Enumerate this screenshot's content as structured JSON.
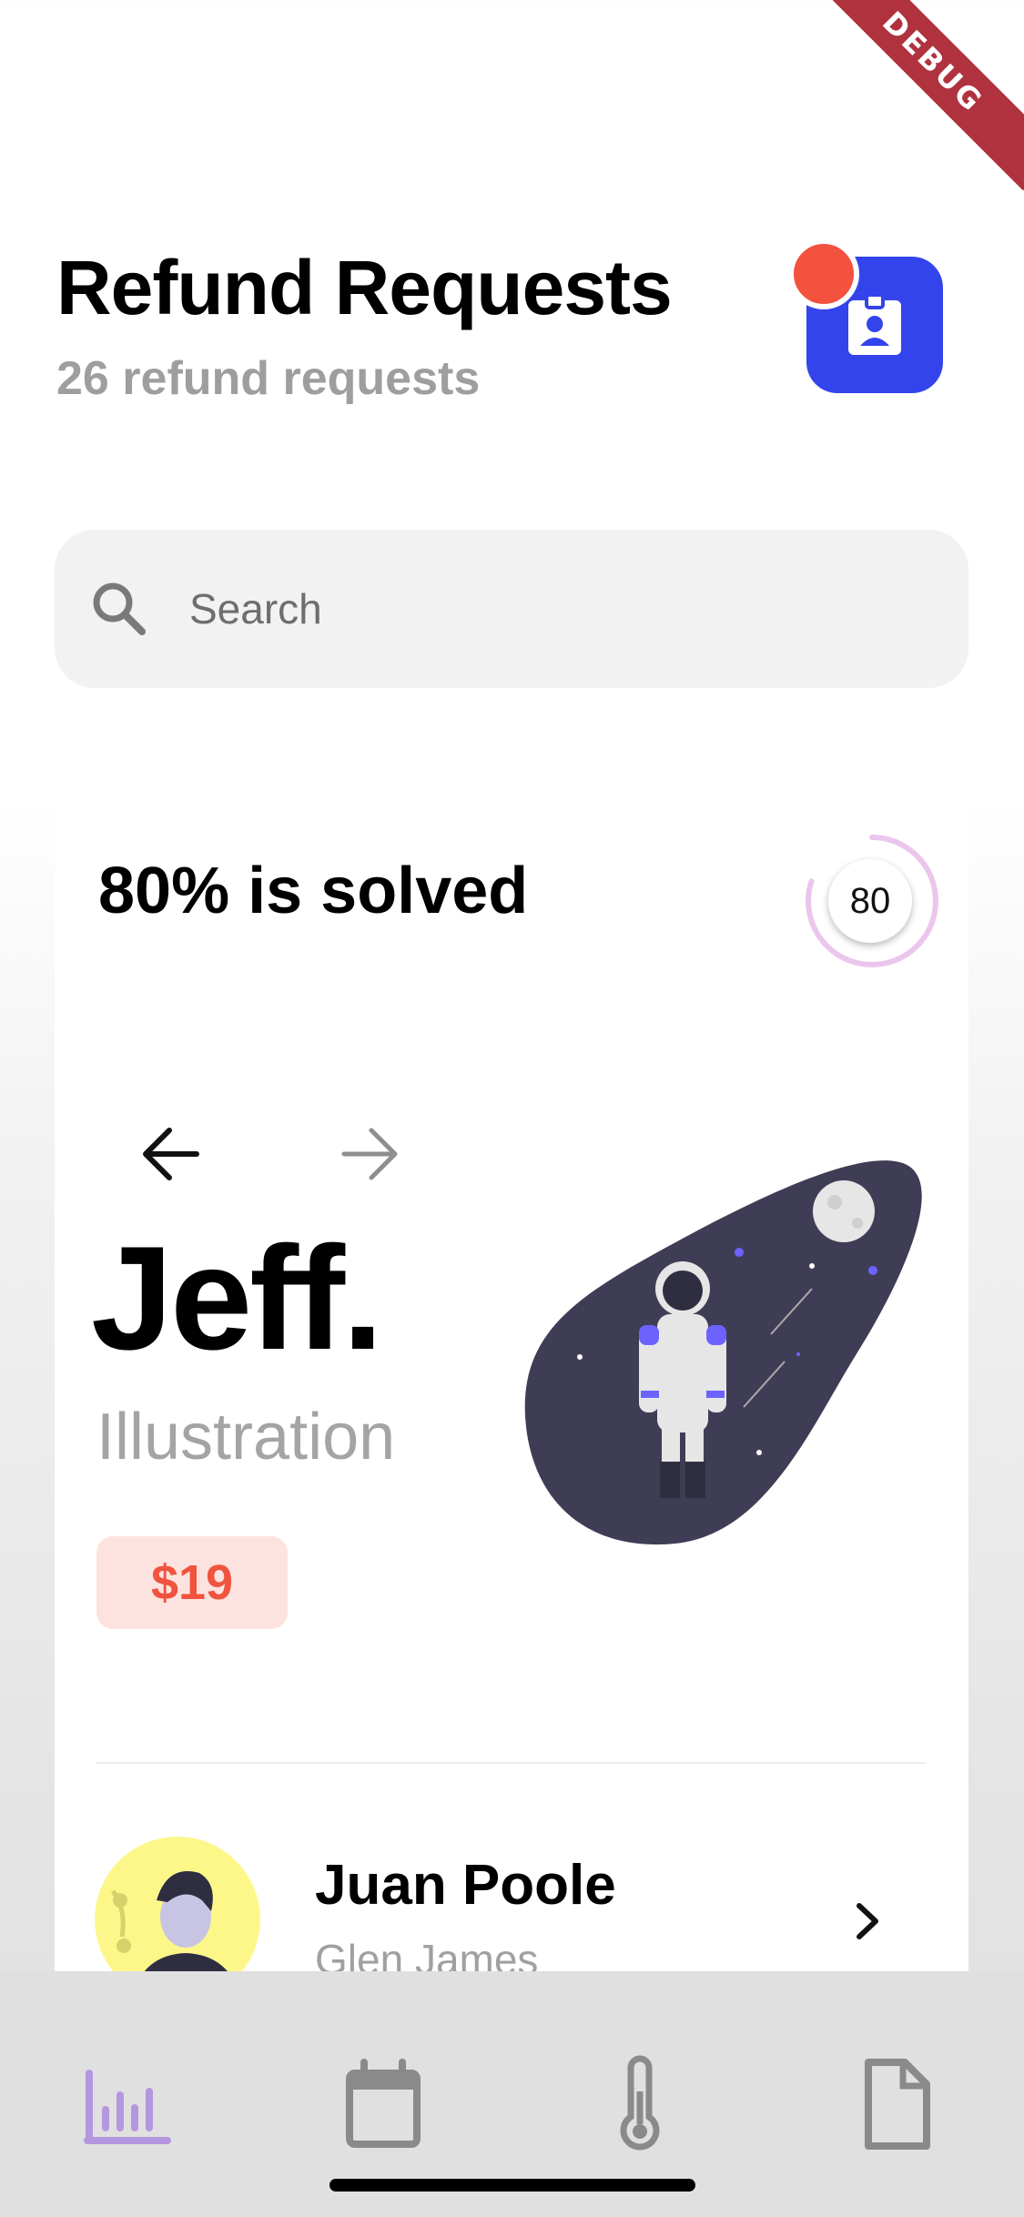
{
  "debug_banner": "DEBUG",
  "header": {
    "title": "Refund Requests",
    "subtitle": "26 refund requests",
    "notification_color": "#f2523e",
    "badge_color": "#3444ec",
    "badge_icon": "id-badge-icon"
  },
  "search": {
    "placeholder": "Search",
    "value": "",
    "icon": "search-icon"
  },
  "progress": {
    "title": "80% is solved",
    "value": 80,
    "ring_color": "#ebc6ec"
  },
  "featured": {
    "name": "Jeff.",
    "role": "Illustration",
    "price": "$19",
    "prev_icon": "arrow-left-icon",
    "next_icon": "arrow-right-icon",
    "illustration": "astronaut-illustration"
  },
  "list": [
    {
      "name": "Juan Poole",
      "subtitle": "Glen James",
      "icon": "chevron-right-icon"
    }
  ],
  "bottom_nav": [
    {
      "icon": "bar-chart-icon",
      "active": true
    },
    {
      "icon": "calendar-icon",
      "active": false
    },
    {
      "icon": "thermometer-icon",
      "active": false
    },
    {
      "icon": "document-icon",
      "active": false
    }
  ],
  "colors": {
    "active_nav": "#b597e0",
    "inactive_nav": "#8a8a8a",
    "price_text": "#f0533e",
    "price_bg": "#fde3e0"
  }
}
